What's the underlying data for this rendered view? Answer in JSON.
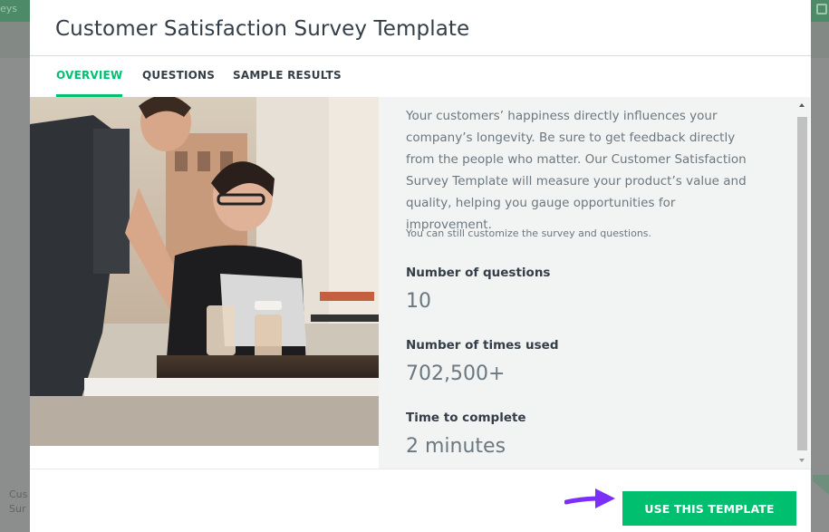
{
  "background": {
    "topbar_fragment": "eys",
    "left_fragment_line1": "Cus",
    "left_fragment_line2": "Sur"
  },
  "modal": {
    "title": "Customer Satisfaction Survey Template",
    "tabs": [
      {
        "label": "OVERVIEW",
        "active": true
      },
      {
        "label": "QUESTIONS",
        "active": false
      },
      {
        "label": "SAMPLE RESULTS",
        "active": false
      }
    ],
    "image_alt": "man-serving-drinks-to-smiling-woman-at-cafe-photo",
    "description": "Your customers’ happiness directly influences your company’s longevity. Be sure to get feedback directly from the people who matter. Our Customer Satisfaction Survey Template will measure your product’s value and quality, helping you gauge opportunities for improvement.",
    "note": "You can still customize the survey and questions.",
    "stats": [
      {
        "label": "Number of questions",
        "value": "10"
      },
      {
        "label": "Number of times used",
        "value": "702,500+"
      },
      {
        "label": "Time to complete",
        "value": "2 minutes"
      }
    ],
    "cta_label": "USE THIS TEMPLATE",
    "colors": {
      "accent": "#00bf6f",
      "annotation_arrow": "#7b2ff7",
      "text_dark": "#333e48",
      "text_muted": "#6b787f"
    },
    "icons": {
      "scroll_up": "chevron-up-icon",
      "scroll_down": "chevron-down-icon",
      "annotation": "arrow-right-icon"
    }
  }
}
